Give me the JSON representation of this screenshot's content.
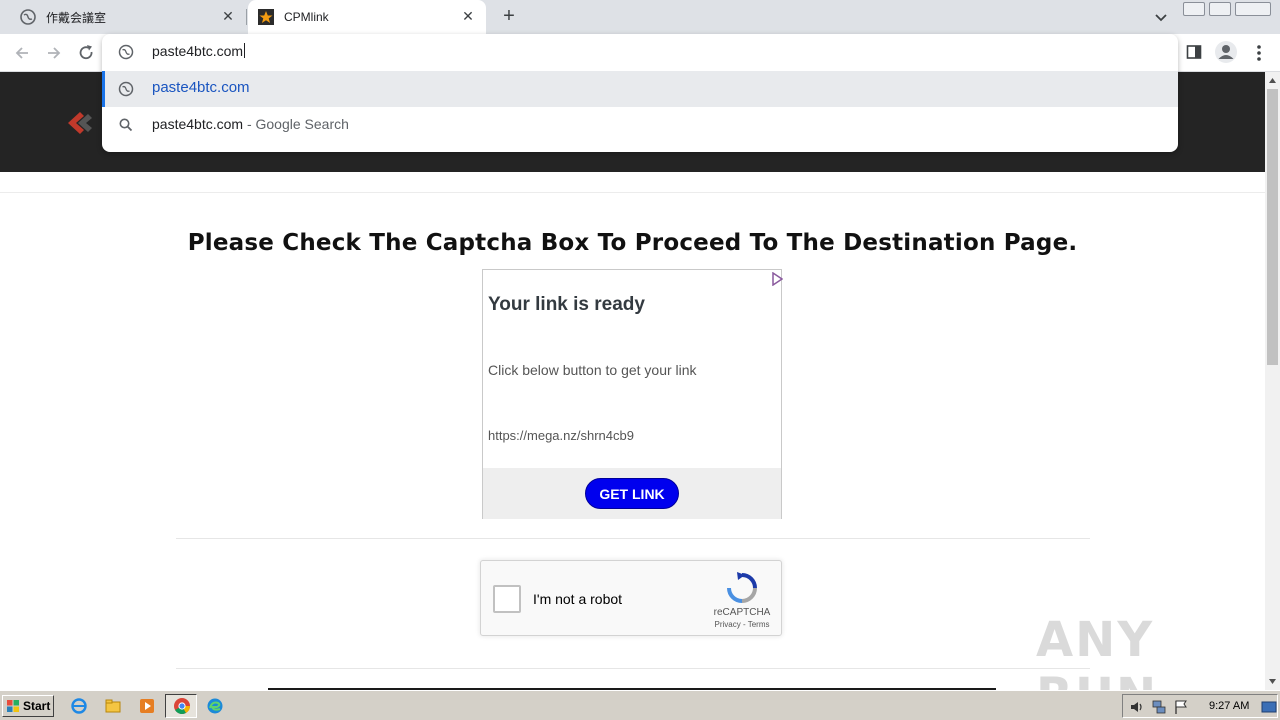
{
  "browser": {
    "tabs": [
      {
        "title": "作戴会議室",
        "active": false
      },
      {
        "title": "CPMlink",
        "active": true
      }
    ],
    "new_tab_label": "+",
    "close_glyph": "✕"
  },
  "omnibox": {
    "input_value": "paste4btc.com",
    "suggestions": [
      {
        "text": "paste4btc.com",
        "suffix": "",
        "icon": "globe-icon",
        "selected": true
      },
      {
        "text": "paste4btc.com",
        "suffix": " - Google Search",
        "icon": "search-icon",
        "selected": false
      }
    ]
  },
  "page": {
    "headline": "Please Check The Captcha Box To Proceed To The Destination Page.",
    "ad": {
      "title": "Your link is ready",
      "text": "Click below button to get your link",
      "url": "https://mega.nz/shrn4cb9",
      "button_label": "GET LINK"
    },
    "recaptcha": {
      "label": "I'm not a robot",
      "brand": "reCAPTCHA",
      "links": "Privacy - Terms"
    },
    "watermark": "ANY RUN"
  },
  "taskbar": {
    "start_label": "Start",
    "clock": "9:27 AM"
  },
  "colors": {
    "accent": "#1a73e8",
    "header_bg": "#242424",
    "get_link_bg": "#0000ee"
  }
}
